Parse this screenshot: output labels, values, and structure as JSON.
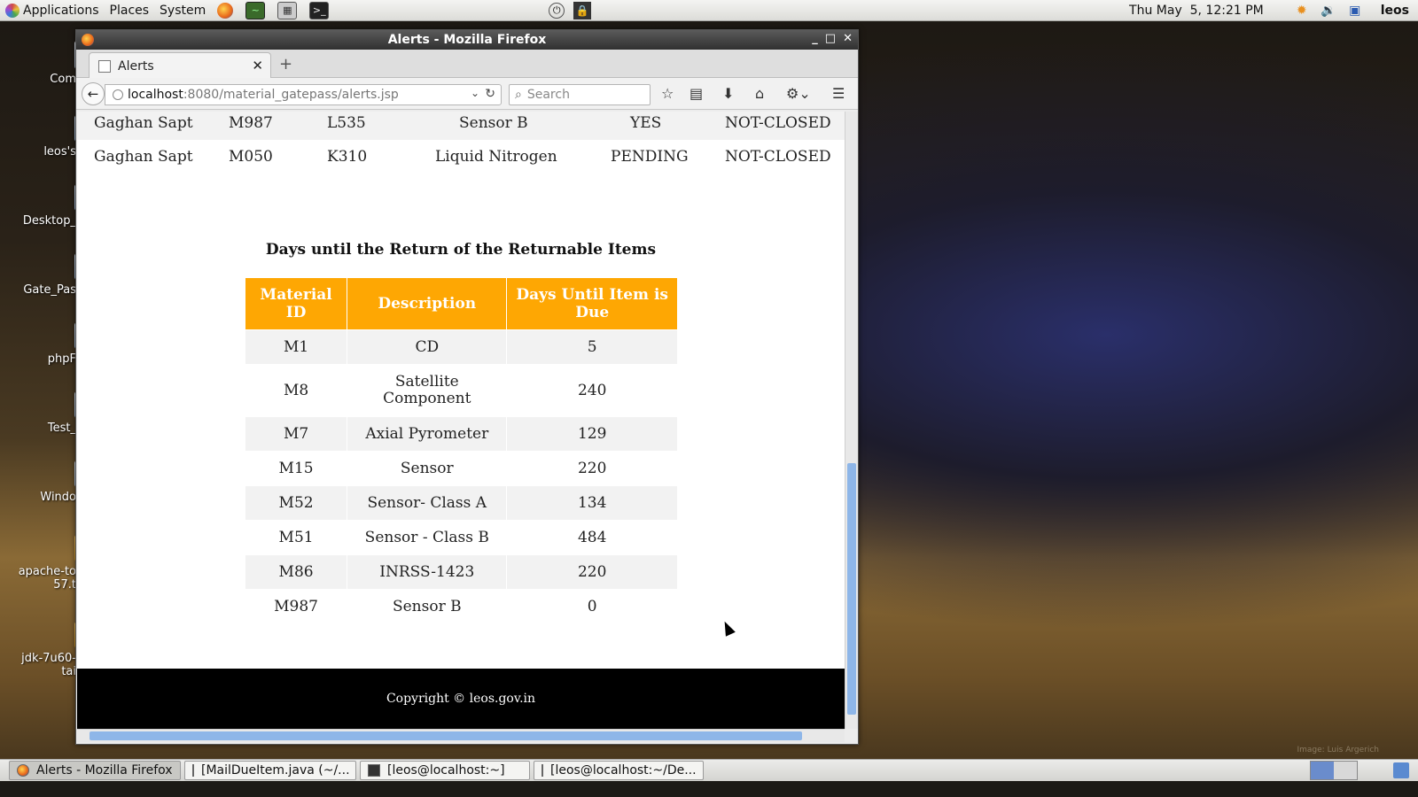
{
  "top_panel": {
    "menus": [
      "Applications",
      "Places",
      "System"
    ],
    "clock": "Thu May  5, 12:21 PM",
    "user": "leos"
  },
  "desktop_icons": [
    "Com",
    "leos's",
    "Desktop_",
    "Gate_Pas",
    "phpF",
    "Test_",
    "Windo",
    "apache-to",
    "57.t",
    "jdk-7u60-",
    "tai"
  ],
  "window": {
    "title": "Alerts - Mozilla Firefox",
    "tab_label": "Alerts",
    "url_host": "localhost",
    "url_path": ":8080/material_gatepass/alerts.jsp",
    "search_placeholder": "Search"
  },
  "top_rows": [
    {
      "name": "Gaghan Sapt",
      "material": "M987",
      "code": "L535",
      "desc": "Sensor B",
      "returnable": "YES",
      "status": "NOT-CLOSED"
    },
    {
      "name": "Gaghan Sapt",
      "material": "M050",
      "code": "K310",
      "desc": "Liquid Nitrogen",
      "returnable": "PENDING",
      "status": "NOT-CLOSED"
    }
  ],
  "returnable": {
    "title": "Days until the Return of the Returnable Items",
    "headers": [
      "Material ID",
      "Description",
      "Days Until Item is Due"
    ],
    "rows": [
      [
        "M1",
        "CD",
        "5"
      ],
      [
        "M8",
        "Satellite Component",
        "240"
      ],
      [
        "M7",
        "Axial Pyrometer",
        "129"
      ],
      [
        "M15",
        "Sensor",
        "220"
      ],
      [
        "M52",
        "Sensor- Class A",
        "134"
      ],
      [
        "M51",
        "Sensor - Class B",
        "484"
      ],
      [
        "M86",
        "INRSS-1423",
        "220"
      ],
      [
        "M987",
        "Sensor B",
        "0"
      ]
    ]
  },
  "footer": "Copyright © leos.gov.in",
  "taskbar": [
    "Alerts - Mozilla Firefox",
    "[MailDueItem.java (~/...",
    "[leos@localhost:~]",
    "[leos@localhost:~/De..."
  ],
  "credit": "Image: Luis Argerich"
}
